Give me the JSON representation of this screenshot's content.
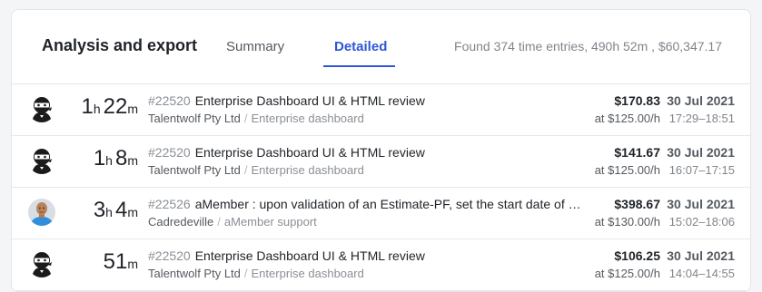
{
  "header": {
    "title": "Analysis and export",
    "tabs": [
      {
        "label": "Summary",
        "active": false
      },
      {
        "label": "Detailed",
        "active": true
      }
    ],
    "found_text": "Found 374 time entries, 490h 52m , $60,347.17"
  },
  "colors": {
    "accent": "#2f56d8",
    "muted_text": "#80858b",
    "border": "#e3e5e8"
  },
  "entries": [
    {
      "avatar_icon": "ninja-avatar-icon",
      "duration": {
        "h": "1",
        "h_unit": "h",
        "m": "22",
        "m_unit": "m"
      },
      "task_id": "#22520",
      "task_name": "Enterprise Dashboard UI & HTML review",
      "client": "Talentwolf Pty Ltd",
      "separator": "/",
      "project": "Enterprise dashboard",
      "amount": "$170.83",
      "rate": "at $125.00/h",
      "date": "30 Jul 2021",
      "time_range": "17:29–18:51"
    },
    {
      "avatar_icon": "ninja-avatar-icon",
      "duration": {
        "h": "1",
        "h_unit": "h",
        "m": "8",
        "m_unit": "m"
      },
      "task_id": "#22520",
      "task_name": "Enterprise Dashboard UI & HTML review",
      "client": "Talentwolf Pty Ltd",
      "separator": "/",
      "project": "Enterprise dashboard",
      "amount": "$141.67",
      "rate": "at $125.00/h",
      "date": "30 Jul 2021",
      "time_range": "16:07–17:15"
    },
    {
      "avatar_icon": "user-photo-avatar-icon",
      "duration": {
        "h": "3",
        "h_unit": "h",
        "m": "4",
        "m_unit": "m"
      },
      "task_id": "#22526",
      "task_name": "aMember : upon validation of an Estimate-PF, set the start date of the subscription",
      "client": "Cadredeville",
      "separator": "/",
      "project": "aMember support",
      "amount": "$398.67",
      "rate": "at $130.00/h",
      "date": "30 Jul 2021",
      "time_range": "15:02–18:06"
    },
    {
      "avatar_icon": "ninja-avatar-icon",
      "duration": {
        "h": "",
        "h_unit": "",
        "m": "51",
        "m_unit": "m"
      },
      "task_id": "#22520",
      "task_name": "Enterprise Dashboard UI & HTML review",
      "client": "Talentwolf Pty Ltd",
      "separator": "/",
      "project": "Enterprise dashboard",
      "amount": "$106.25",
      "rate": "at $125.00/h",
      "date": "30 Jul 2021",
      "time_range": "14:04–14:55"
    }
  ]
}
